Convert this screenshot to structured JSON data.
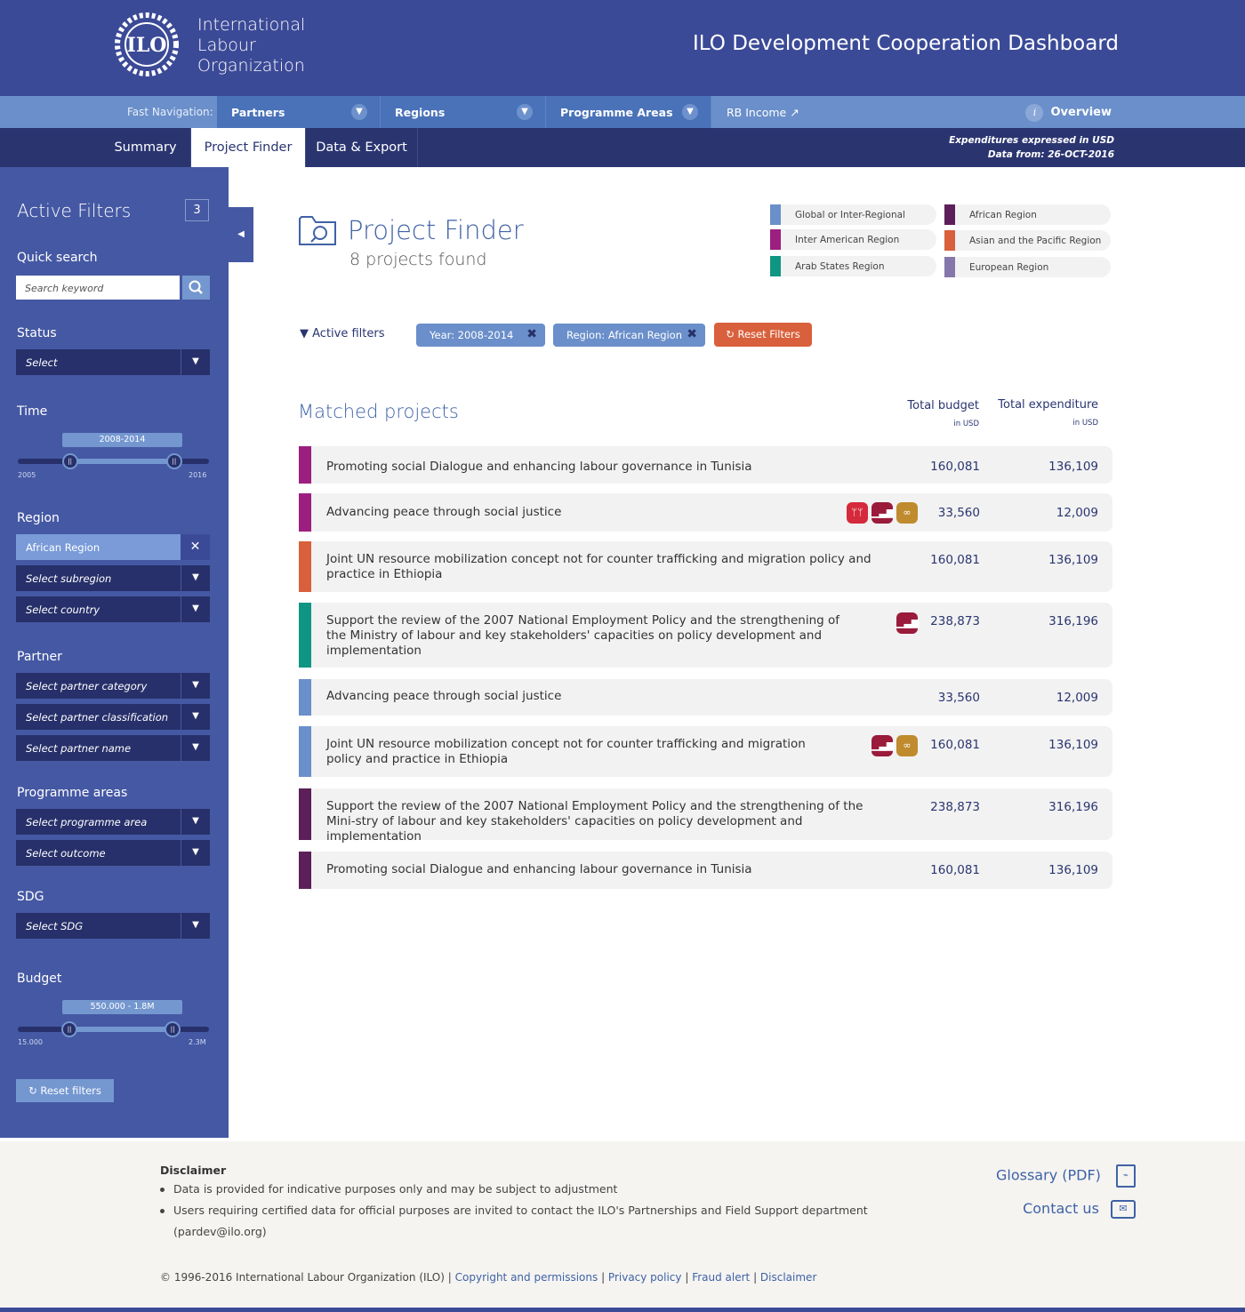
{
  "header": {
    "org_lines": [
      "International",
      "Labour",
      "Organization"
    ],
    "logo_text": "ILO",
    "title": "ILO Development Cooperation Dashboard"
  },
  "fastnav": {
    "label": "Fast Navigation:",
    "items": [
      "Partners",
      "Regions",
      "Programme Areas"
    ],
    "rb_income": "RB Income",
    "overview": "Overview",
    "info_glyph": "i"
  },
  "tabs": [
    "Summary",
    "Project Finder",
    "Data & Export"
  ],
  "active_tab": "Project Finder",
  "meta": {
    "expenditures": "Expenditures expressed in USD",
    "data_from": "Data from: 26-OCT-2016"
  },
  "sidebar": {
    "title": "Active Filters",
    "count": "3",
    "quick_search": {
      "label": "Quick search",
      "placeholder": "Search keyword"
    },
    "status": {
      "label": "Status",
      "value": "Select"
    },
    "time": {
      "label": "Time",
      "range": "2008-2014",
      "min": "2005",
      "max": "2016",
      "low_value": 2008,
      "high_value": 2014,
      "domain": [
        2005,
        2016
      ]
    },
    "region": {
      "label": "Region",
      "selected": "African Region",
      "subregion": "Select subregion",
      "country": "Select country"
    },
    "partner": {
      "label": "Partner",
      "category": "Select partner category",
      "classification": "Select partner classification",
      "name": "Select partner name"
    },
    "programme": {
      "label": "Programme areas",
      "area": "Select programme area",
      "outcome": "Select outcome"
    },
    "sdg": {
      "label": "SDG",
      "value": "Select SDG"
    },
    "budget": {
      "label": "Budget",
      "range": "550.000 - 1.8M",
      "min": "15.000",
      "max": "2.3M",
      "low_fraction": 0.27,
      "high_fraction": 0.81
    },
    "reset": "Reset filters"
  },
  "finder": {
    "title": "Project Finder",
    "count": "8 projects found"
  },
  "legend": [
    {
      "label": "Global or Inter-Regional",
      "color": "#6a8fca"
    },
    {
      "label": "African Region",
      "color": "#5c1f5a"
    },
    {
      "label": "Inter American Region",
      "color": "#9c1f80"
    },
    {
      "label": "Asian and the Pacific Region",
      "color": "#d9603c"
    },
    {
      "label": "Arab States Region",
      "color": "#0f9683"
    },
    {
      "label": "European Region",
      "color": "#8577a9"
    }
  ],
  "filters": {
    "label": "Active filters",
    "chips": [
      "Year: 2008-2014",
      "Region: African Region"
    ],
    "reset": "Reset Filters"
  },
  "matched": {
    "title": "Matched projects",
    "col_budget": "Total budget",
    "col_exp": "Total expenditure",
    "unit": "in USD"
  },
  "projects": [
    {
      "title": "Promoting social Dialogue and enhancing labour governance in Tunisia",
      "budget": "160,081",
      "expenditure": "136,109",
      "color": "#9c1f80",
      "sdgs": []
    },
    {
      "title": "Advancing peace through social justice",
      "budget": "33,560",
      "expenditure": "12,009",
      "color": "#9c1f80",
      "sdgs": [
        "people-icon",
        "growth-chart-icon",
        "infinity-icon"
      ]
    },
    {
      "title": "Joint UN resource mobilization concept not for counter trafficking and migration policy and practice in Ethiopia",
      "budget": "160,081",
      "expenditure": "136,109",
      "color": "#d9603c",
      "sdgs": []
    },
    {
      "title": "Support the review of the 2007 National Employment Policy and the strengthening of the Ministry of labour and key stakeholders' capacities on policy development and implementation",
      "budget": "238,873",
      "expenditure": "316,196",
      "color": "#0f9683",
      "sdgs": [
        "growth-chart-icon"
      ]
    },
    {
      "title": "Advancing peace through social justice",
      "budget": "33,560",
      "expenditure": "12,009",
      "color": "#6a8fca",
      "sdgs": []
    },
    {
      "title": "Joint UN resource mobilization concept not for counter trafficking and migration policy and practice in Ethiopia",
      "budget": "160,081",
      "expenditure": "136,109",
      "color": "#6a8fca",
      "sdgs": [
        "growth-chart-icon",
        "infinity-icon"
      ]
    },
    {
      "title": "Support the review of the 2007 National Employment Policy and the strengthening of the Mini-stry of labour and key stakeholders' capacities on policy development and implementation",
      "budget": "238,873",
      "expenditure": "316,196",
      "color": "#5c1f5a",
      "sdgs": []
    },
    {
      "title": "Promoting social Dialogue and enhancing labour governance in Tunisia",
      "budget": "160,081",
      "expenditure": "136,109",
      "color": "#5c1f5a",
      "sdgs": []
    }
  ],
  "footer": {
    "disclaimer_title": "Disclaimer",
    "items": [
      "Data is provided for indicative purposes only and may be subject to adjustment",
      "Users requiring certified data for official purposes are invited to contact the ILO's Partnerships and Field Support department",
      "(pardev@ilo.org)"
    ],
    "glossary": "Glossary (PDF)",
    "contact": "Contact us",
    "copyright": "© 1996-2016 International Labour Organization (ILO) |",
    "links": [
      "Copyright and permissions",
      "Privacy policy",
      "Fraud alert",
      "Disclaimer"
    ]
  }
}
